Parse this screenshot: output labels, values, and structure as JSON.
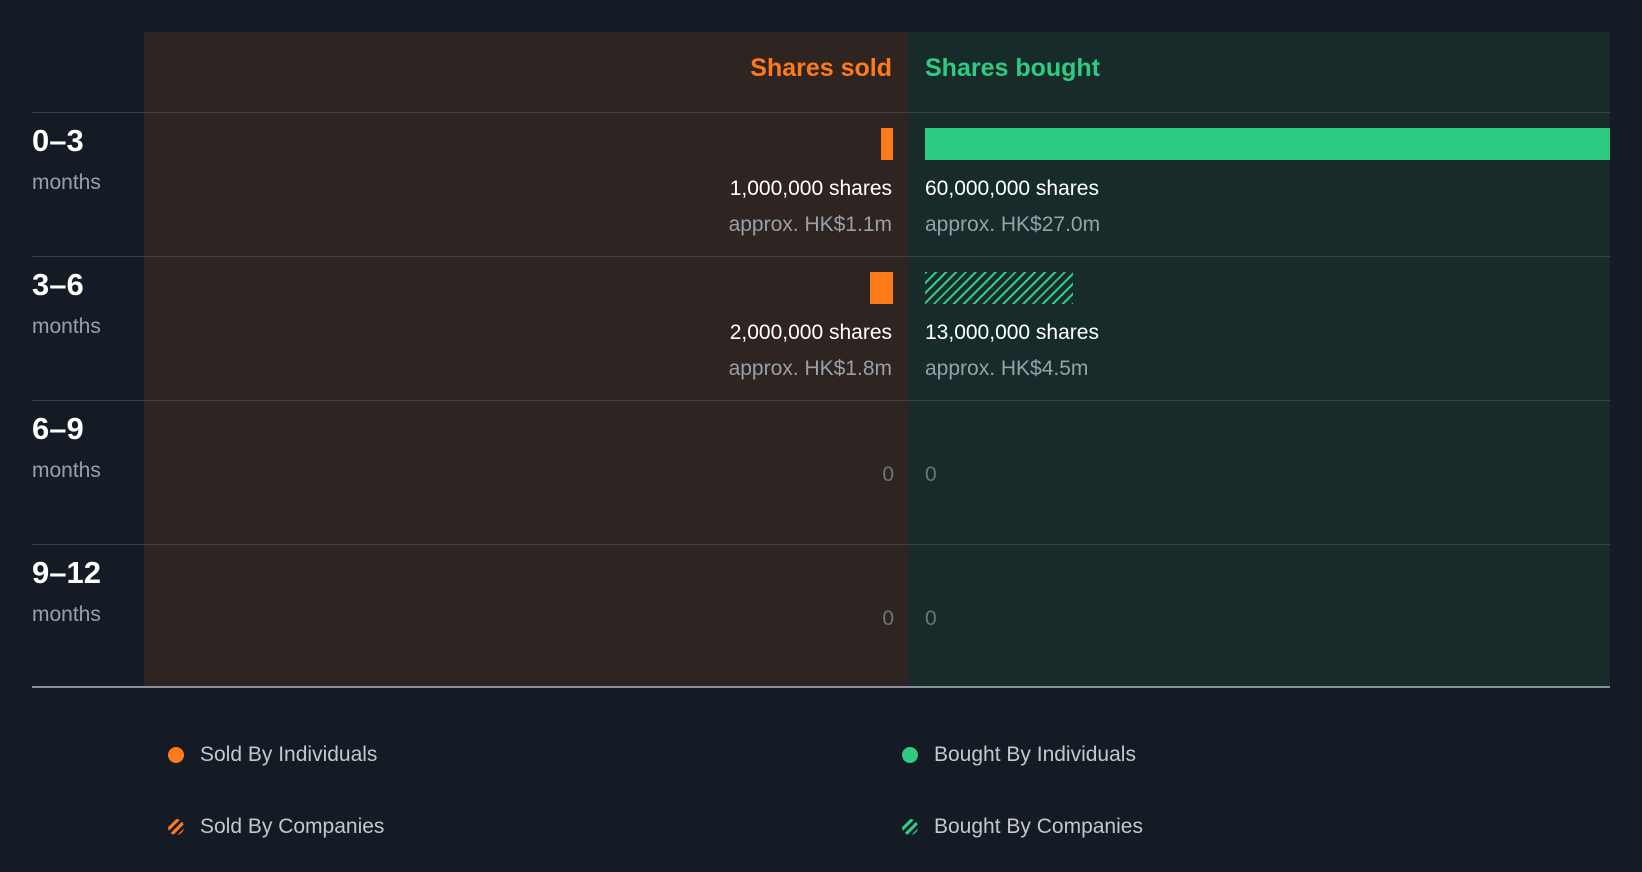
{
  "colors": {
    "sold": "#ff7a1a",
    "bought": "#2ecc82",
    "sold_panel": "#2e2422",
    "bought_panel": "#172b2a",
    "background": "#151b24"
  },
  "header": {
    "sold_label": "Shares sold",
    "bought_label": "Shares bought"
  },
  "chart_data": {
    "type": "bar",
    "orientation": "horizontal-diverging",
    "categories": [
      "0–3 months",
      "3–6 months",
      "6–9 months",
      "9–12 months"
    ],
    "series": [
      {
        "name": "Shares sold",
        "values": [
          1000000,
          2000000,
          0,
          0
        ]
      },
      {
        "name": "Shares bought",
        "values": [
          60000000,
          13000000,
          0,
          0
        ]
      }
    ],
    "xlim": [
      0,
      60000000
    ]
  },
  "rows": [
    {
      "period": "0–3",
      "unit": "months",
      "sold": {
        "value": 1000000,
        "type": "individuals",
        "shares_text": "1,000,000 shares",
        "approx_text": "approx. HK$1.1m"
      },
      "bought": {
        "value": 60000000,
        "type": "individuals",
        "shares_text": "60,000,000 shares",
        "approx_text": "approx. HK$27.0m"
      }
    },
    {
      "period": "3–6",
      "unit": "months",
      "sold": {
        "value": 2000000,
        "type": "individuals",
        "shares_text": "2,000,000 shares",
        "approx_text": "approx. HK$1.8m"
      },
      "bought": {
        "value": 13000000,
        "type": "companies",
        "shares_text": "13,000,000 shares",
        "approx_text": "approx. HK$4.5m"
      }
    },
    {
      "period": "6–9",
      "unit": "months",
      "sold": {
        "value": 0,
        "zero_text": "0"
      },
      "bought": {
        "value": 0,
        "zero_text": "0"
      }
    },
    {
      "period": "9–12",
      "unit": "months",
      "sold": {
        "value": 0,
        "zero_text": "0"
      },
      "bought": {
        "value": 0,
        "zero_text": "0"
      }
    }
  ],
  "legend": [
    {
      "label": "Sold By Individuals",
      "color": "#ff7a1a",
      "style": "solid"
    },
    {
      "label": "Bought By Individuals",
      "color": "#2ecc82",
      "style": "solid"
    },
    {
      "label": "Sold By Companies",
      "color": "#ff7a1a",
      "style": "hatched"
    },
    {
      "label": "Bought By Companies",
      "color": "#2ecc82",
      "style": "hatched"
    }
  ]
}
